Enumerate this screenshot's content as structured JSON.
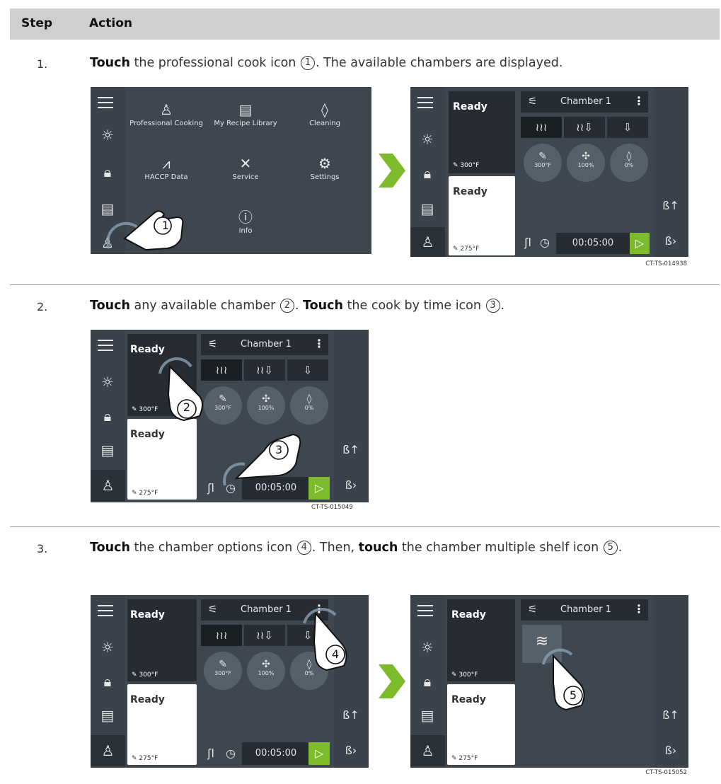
{
  "header": {
    "step": "Step",
    "action": "Action"
  },
  "steps": [
    {
      "num": "1.",
      "parts": {
        "a": "Touch",
        "b": " the professional cook icon ",
        "c": "1",
        "d": ". The available chambers are displayed."
      }
    },
    {
      "num": "2.",
      "parts": {
        "a": "Touch",
        "b": " any available chamber ",
        "c": "2",
        "d": ". ",
        "e": "Touch",
        "f": " the cook by time icon ",
        "g": "3",
        "h": "."
      }
    },
    {
      "num": "3.",
      "parts": {
        "a": "Touch",
        "b": " the chamber options icon ",
        "c": "4",
        "d": ". Then, ",
        "e": "touch",
        "f": " the chamber multiple shelf icon ",
        "g": "5",
        "h": "."
      }
    }
  ],
  "menu": {
    "items": [
      "Professional Cooking",
      "My Recipe Library",
      "Cleaning",
      "HACCP Data",
      "Service",
      "Settings",
      "Info"
    ]
  },
  "oven": {
    "ready": "Ready",
    "temp_top": "300°F",
    "temp_bottom": "275°F",
    "chamber": "Chamber 1",
    "dial_temp": "300°F",
    "dial_fan": "100%",
    "dial_humidity": "0%",
    "timer": "00:05:00"
  },
  "callouts": [
    "1",
    "2",
    "3",
    "4",
    "5"
  ],
  "captions": [
    "CT-TS-014938",
    "CT-TS-015049",
    "CT-TS-015052"
  ],
  "colors": {
    "accent_green": "#7dbb2c",
    "screen_bg": "#3e474f",
    "card_dark": "#262c31",
    "header_bg": "#cfcfcf"
  }
}
